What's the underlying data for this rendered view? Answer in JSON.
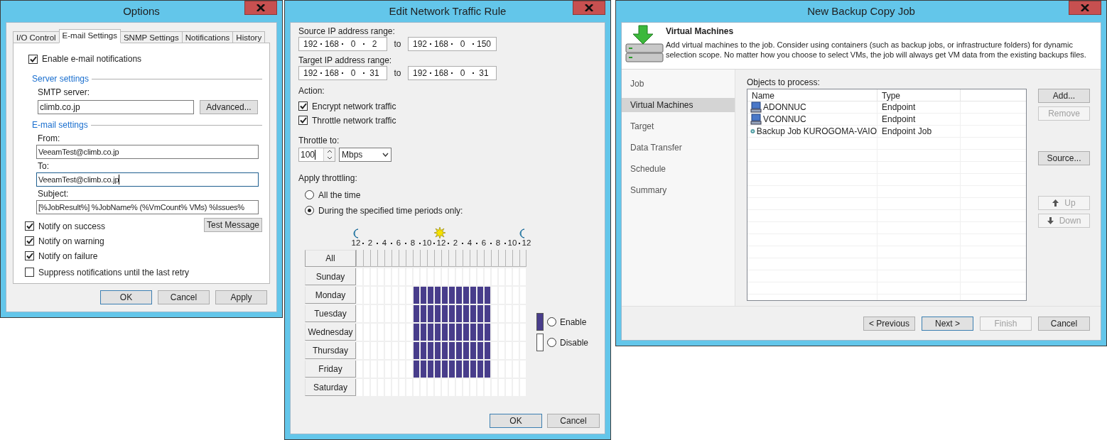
{
  "options": {
    "title": "Options",
    "tabs": [
      {
        "label": "I/O Control",
        "selected": false
      },
      {
        "label": "E-mail Settings",
        "selected": true
      },
      {
        "label": "SNMP Settings",
        "selected": false
      },
      {
        "label": "Notifications",
        "selected": false
      },
      {
        "label": "History",
        "selected": false
      }
    ],
    "enable": {
      "label": "Enable e-mail notifications",
      "checked": true
    },
    "server_settings": {
      "heading": "Server settings",
      "smtp_label": "SMTP server:",
      "smtp_value": "climb.co.jp",
      "advanced_button": "Advanced..."
    },
    "email_settings": {
      "heading": "E-mail settings",
      "fields": [
        {
          "label": "From:",
          "value": "VeeamTest@climb.co.jp",
          "focused": false
        },
        {
          "label": "To:",
          "value": "VeeamTest@climb.co.jp",
          "focused": true
        },
        {
          "label": "Subject:",
          "value": "[%JobResult%] %JobName% (%VmCount% VMs) %Issues%",
          "focused": false
        }
      ]
    },
    "test_button": "Test Message",
    "notify": [
      {
        "label": "Notify on success",
        "checked": true
      },
      {
        "label": "Notify on warning",
        "checked": true
      },
      {
        "label": "Notify on failure",
        "checked": true
      },
      {
        "label": "Suppress notifications until the last retry",
        "checked": false
      }
    ],
    "buttons": [
      {
        "label": "OK",
        "default": true
      },
      {
        "label": "Cancel",
        "default": false
      },
      {
        "label": "Apply",
        "default": false
      }
    ]
  },
  "traffic_rule": {
    "title": "Edit Network Traffic Rule",
    "ranges": [
      {
        "label": "Source IP address range:",
        "from": [
          "192",
          "168",
          "0",
          "2"
        ],
        "to_label": "to",
        "to": [
          "192",
          "168",
          "0",
          "150"
        ]
      },
      {
        "label": "Target IP address range:",
        "from": [
          "192",
          "168",
          "0",
          "31"
        ],
        "to_label": "to",
        "to": [
          "192",
          "168",
          "0",
          "31"
        ]
      }
    ],
    "action_label": "Action:",
    "actions": [
      {
        "label": "Encrypt network traffic",
        "checked": true
      },
      {
        "label": "Throttle network traffic",
        "checked": true
      }
    ],
    "throttle_label": "Throttle to:",
    "throttle_value": "100",
    "throttle_unit": "Mbps",
    "apply_label": "Apply throttling:",
    "apply_options": [
      {
        "label": "All the time",
        "selected": false
      },
      {
        "label": "During the specified time periods only:",
        "selected": true
      }
    ],
    "schedule": {
      "hour_labels": [
        "12",
        "2",
        "4",
        "6",
        "8",
        "10",
        "12",
        "2",
        "4",
        "6",
        "8",
        "10",
        "12"
      ],
      "all_label": "All",
      "days": [
        {
          "label": "Sunday",
          "hours": [
            false,
            false,
            false,
            false,
            false,
            false,
            false,
            false,
            false,
            false,
            false,
            false,
            false,
            false,
            false,
            false,
            false,
            false,
            false,
            false,
            false,
            false,
            false,
            false
          ]
        },
        {
          "label": "Monday",
          "hours": [
            false,
            false,
            false,
            false,
            false,
            false,
            false,
            false,
            true,
            true,
            true,
            true,
            true,
            true,
            true,
            true,
            true,
            true,
            true,
            false,
            false,
            false,
            false,
            false
          ]
        },
        {
          "label": "Tuesday",
          "hours": [
            false,
            false,
            false,
            false,
            false,
            false,
            false,
            false,
            true,
            true,
            true,
            true,
            true,
            true,
            true,
            true,
            true,
            true,
            true,
            false,
            false,
            false,
            false,
            false
          ]
        },
        {
          "label": "Wednesday",
          "hours": [
            false,
            false,
            false,
            false,
            false,
            false,
            false,
            false,
            true,
            true,
            true,
            true,
            true,
            true,
            true,
            true,
            true,
            true,
            true,
            false,
            false,
            false,
            false,
            false
          ]
        },
        {
          "label": "Thursday",
          "hours": [
            false,
            false,
            false,
            false,
            false,
            false,
            false,
            false,
            true,
            true,
            true,
            true,
            true,
            true,
            true,
            true,
            true,
            true,
            true,
            false,
            false,
            false,
            false,
            false
          ]
        },
        {
          "label": "Friday",
          "hours": [
            false,
            false,
            false,
            false,
            false,
            false,
            false,
            false,
            true,
            true,
            true,
            true,
            true,
            true,
            true,
            true,
            true,
            true,
            true,
            false,
            false,
            false,
            false,
            false
          ]
        },
        {
          "label": "Saturday",
          "hours": [
            false,
            false,
            false,
            false,
            false,
            false,
            false,
            false,
            false,
            false,
            false,
            false,
            false,
            false,
            false,
            false,
            false,
            false,
            false,
            false,
            false,
            false,
            false,
            false
          ]
        }
      ]
    },
    "legend": [
      {
        "label": "Enable",
        "kind": "enable",
        "selected": false
      },
      {
        "label": "Disable",
        "kind": "disable",
        "selected": false
      }
    ],
    "buttons": [
      {
        "label": "OK",
        "default": true
      },
      {
        "label": "Cancel",
        "default": false
      }
    ]
  },
  "backup_job": {
    "title": "New Backup Copy Job",
    "header": {
      "title": "Virtual Machines",
      "description": "Add virtual machines to the job. Consider using containers (such as backup jobs, or infrastructure folders) for dynamic selection scope. No matter how you choose to select VMs, the job will always get VM data from the existing backups files."
    },
    "steps": [
      {
        "label": "Job",
        "selected": false
      },
      {
        "label": "Virtual Machines",
        "selected": true
      },
      {
        "label": "Target",
        "selected": false
      },
      {
        "label": "Data Transfer",
        "selected": false
      },
      {
        "label": "Schedule",
        "selected": false
      },
      {
        "label": "Summary",
        "selected": false
      }
    ],
    "objects_label": "Objects to process:",
    "columns": [
      "Name",
      "Type"
    ],
    "rows": [
      {
        "kind": "computer",
        "name": "ADONNUC",
        "type": "Endpoint"
      },
      {
        "kind": "computer",
        "name": "VCONNUC",
        "type": "Endpoint"
      },
      {
        "kind": "job",
        "name": "Backup Job KUROGOMA-VAIO",
        "type": "Endpoint Job"
      }
    ],
    "side_buttons": [
      {
        "label": "Add...",
        "disabled": false
      },
      {
        "label": "Remove",
        "disabled": true
      },
      {
        "label": "Source...",
        "disabled": false
      },
      {
        "label": "Up",
        "disabled": true
      },
      {
        "label": "Down",
        "disabled": true
      }
    ],
    "footer_buttons": [
      {
        "label": "< Previous",
        "disabled": false,
        "default": false
      },
      {
        "label": "Next >",
        "disabled": false,
        "default": true
      },
      {
        "label": "Finish",
        "disabled": true,
        "default": false
      },
      {
        "label": "Cancel",
        "disabled": false,
        "default": false
      }
    ]
  }
}
